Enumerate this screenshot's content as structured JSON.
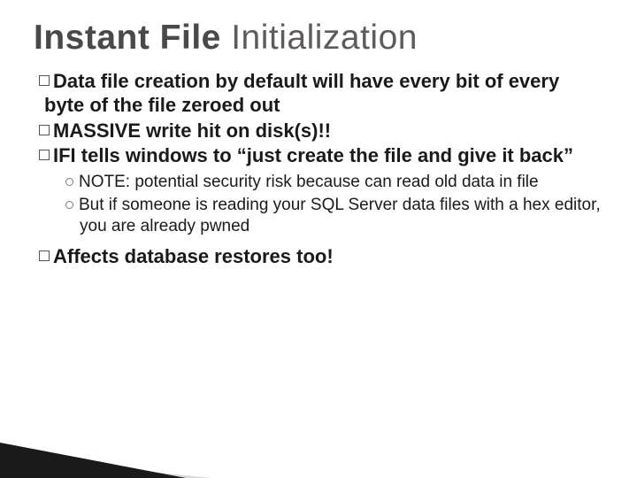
{
  "title_strong": "Instant File",
  "title_rest": " Initialization",
  "bullets": {
    "b1": "Data file creation by default will have every bit of every byte of the file zeroed out",
    "b2": "MASSIVE write hit on disk(s)!!",
    "b3": "IFI tells windows to “just create the file and give it back”",
    "b4": "Affects database restores too!"
  },
  "sub": {
    "s1": "NOTE: potential security risk because can read old data in file",
    "s2": "But if someone is reading your SQL Server data files with a hex editor, you are already pwned"
  }
}
